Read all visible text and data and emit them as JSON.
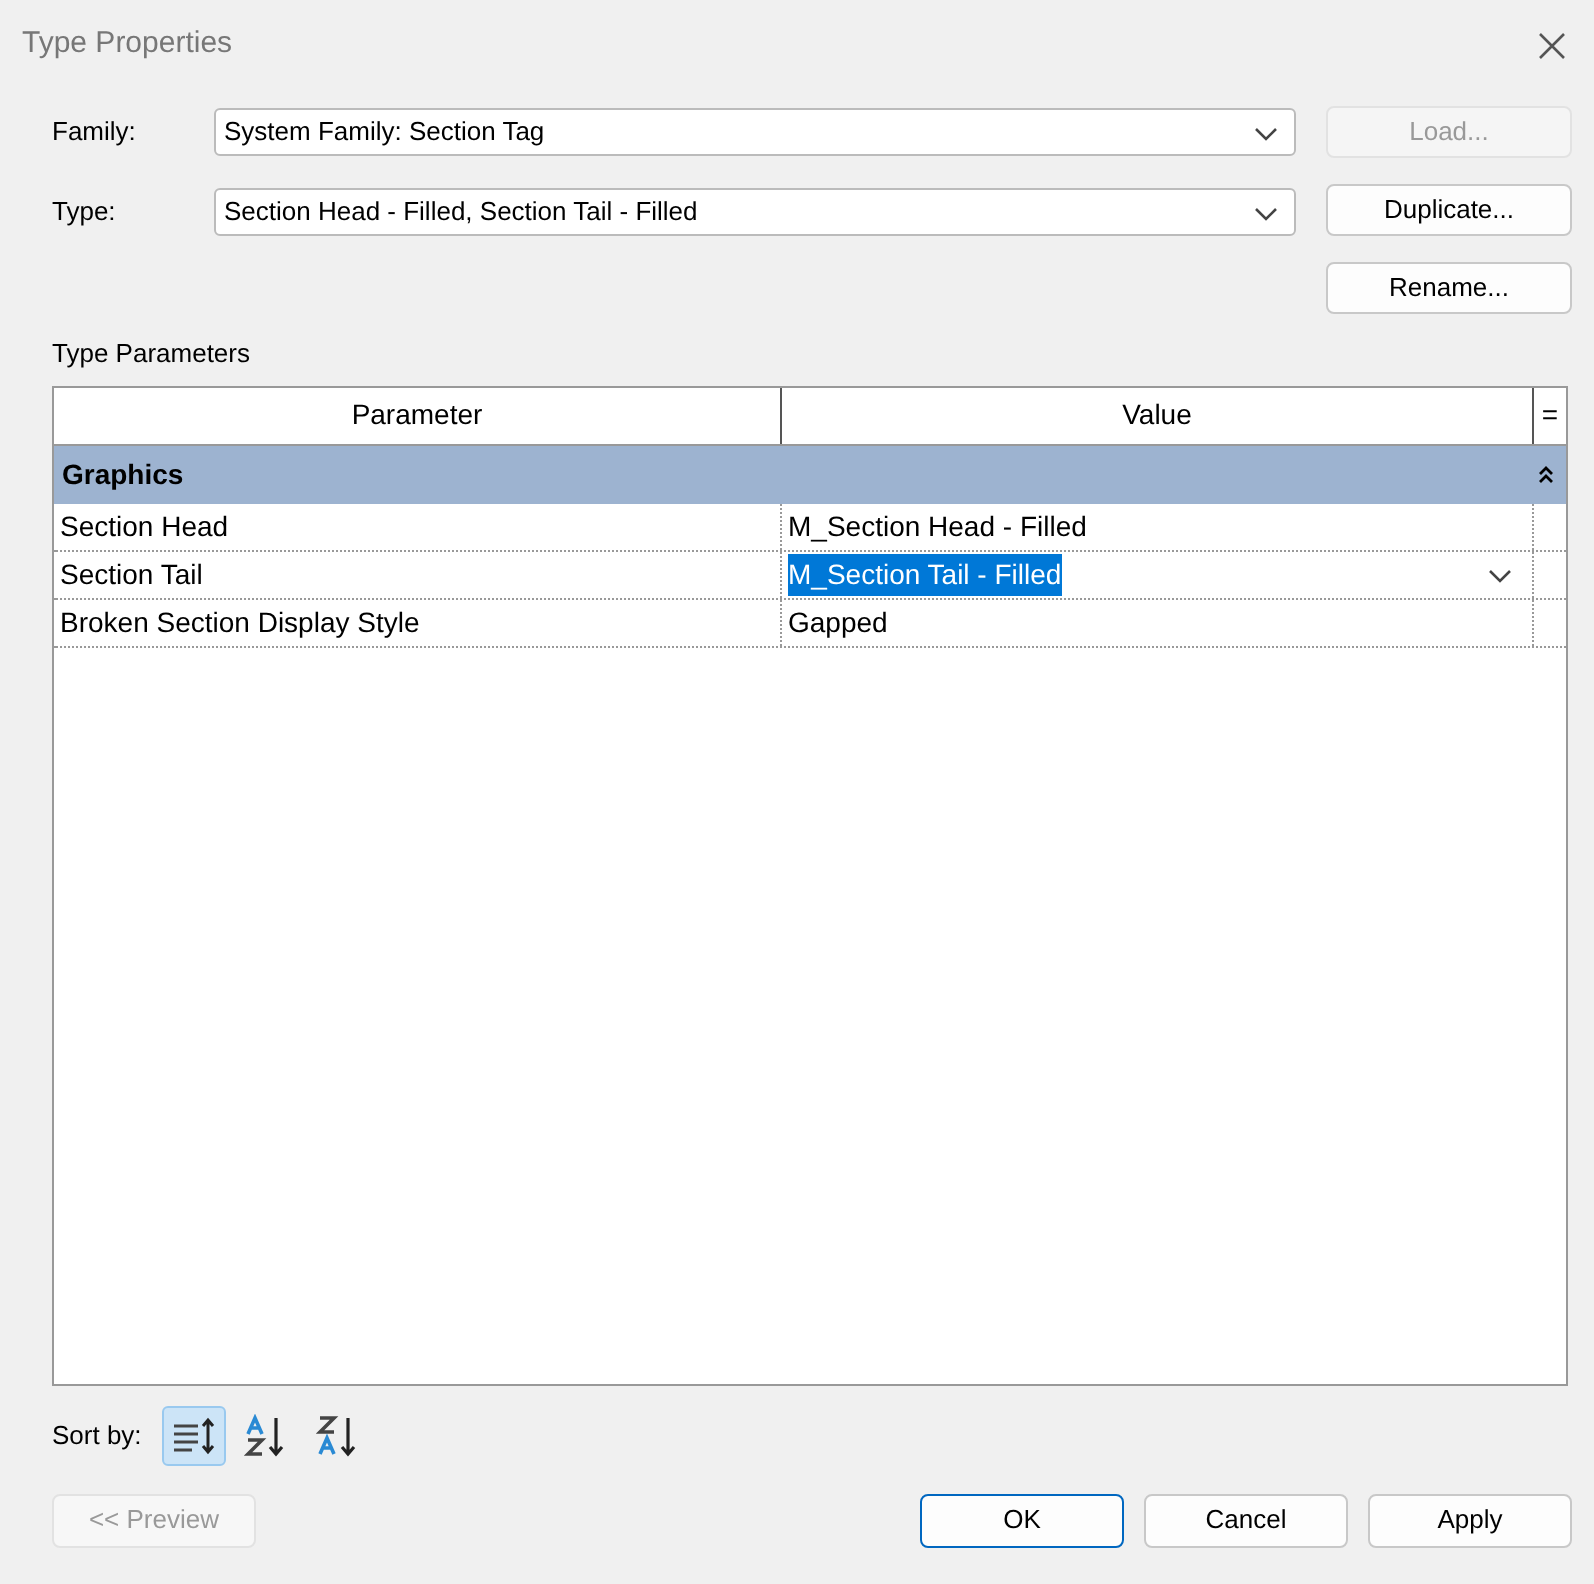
{
  "window": {
    "title": "Type Properties"
  },
  "fields": [
    {
      "label": "Family:",
      "value": "System Family: Section Tag"
    },
    {
      "label": "Type:",
      "value": "Section Head - Filled, Section Tail - Filled"
    }
  ],
  "side_buttons": [
    {
      "label": "Load...",
      "disabled": true
    },
    {
      "label": "Duplicate...",
      "disabled": false
    },
    {
      "label": "Rename...",
      "disabled": false
    }
  ],
  "section_label": "Type Parameters",
  "table": {
    "columns": [
      "Parameter",
      "Value"
    ],
    "menu_glyph": "=",
    "groups": [
      {
        "name": "Graphics",
        "expanded": true,
        "rows": [
          {
            "parameter": "Section Head",
            "value": "M_Section Head - Filled",
            "selected": false
          },
          {
            "parameter": "Section Tail",
            "value": "M_Section Tail - Filled",
            "selected": true
          },
          {
            "parameter": "Broken Section Display Style",
            "value": "Gapped",
            "selected": false
          }
        ]
      }
    ]
  },
  "sort": {
    "label": "Sort by:",
    "options": [
      {
        "kind": "grouped",
        "selected": true
      },
      {
        "kind": "ascending",
        "selected": false
      },
      {
        "kind": "descending",
        "selected": false
      }
    ]
  },
  "buttons": [
    {
      "label": "<< Preview",
      "disabled": true,
      "default": false
    },
    {
      "label": "OK",
      "disabled": false,
      "default": true
    },
    {
      "label": "Cancel",
      "disabled": false,
      "default": false
    },
    {
      "label": "Apply",
      "disabled": false,
      "default": false
    }
  ]
}
